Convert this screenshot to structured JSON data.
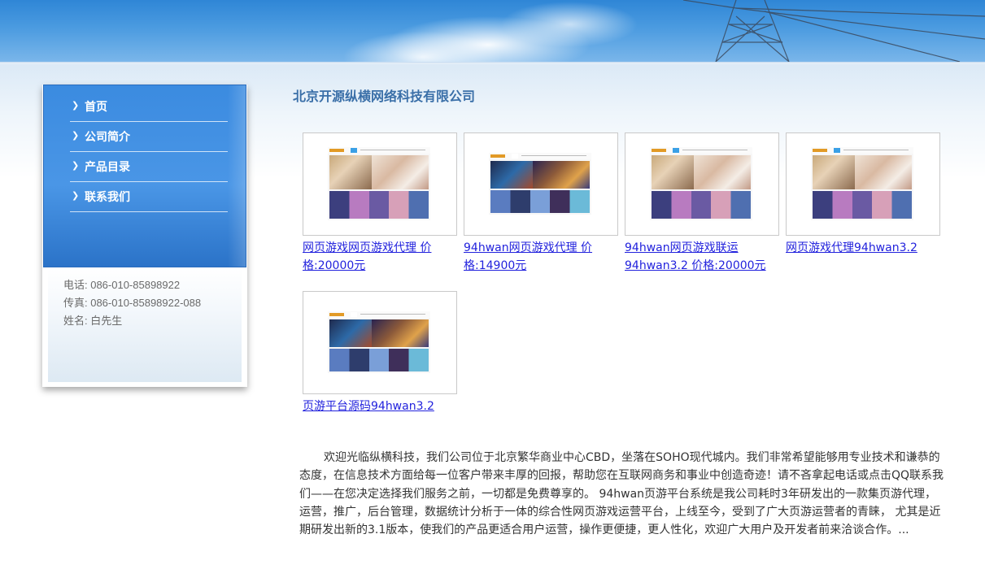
{
  "company": {
    "name": "北京开源纵横网络科技有限公司"
  },
  "sidebar": {
    "items": [
      {
        "label": "首页"
      },
      {
        "label": "公司简介"
      },
      {
        "label": "产品目录"
      },
      {
        "label": "联系我们"
      }
    ],
    "contact": {
      "phone": "电话: 086-010-85898922",
      "fax": "传真: 086-010-85898922-088",
      "name": "姓名: 白先生"
    }
  },
  "products": [
    {
      "label": "网页游戏网页游戏代理 价格:20000元",
      "thumb": "game-site-preview-icon"
    },
    {
      "label": "94hwan网页游戏代理 价格:14900元",
      "thumb": "game-site-preview-icon"
    },
    {
      "label": "94hwan网页游戏联运94hwan3.2 价格:20000元",
      "thumb": "game-site-preview-icon"
    },
    {
      "label": "网页游戏代理94hwan3.2",
      "thumb": "game-site-preview-icon"
    },
    {
      "label": "页游平台源码94hwan3.2",
      "thumb": "game-site-preview-icon"
    }
  ],
  "intro": {
    "text": "欢迎光临纵横科技，我们公司位于北京繁华商业中心CBD，坐落在SOHO现代城内。我们非常希望能够用专业技术和谦恭的态度，在信息技术方面给每一位客户带来丰厚的回报，帮助您在互联网商务和事业中创造奇迹！请不吝拿起电话或点击QQ联系我们——在您决定选择我们服务之前，一切都是免费尊享的。 94hwan页游平台系统是我公司耗时3年研发出的一款集页游代理，运营，推广，后台管理，数据统计分析于一体的综合性网页游戏运营平台，上线至今，受到了广大页游运营者的青睐， 尤其是近期研发出新的3.1版本，使我们的产品更适合用户运营，操作更便捷，更人性化，欢迎广大用户及开发者前来洽谈合作。..."
  },
  "colors": {
    "nav_blue": "#3b8be0",
    "title_blue": "#3a6fa8",
    "link": "#2222dd"
  }
}
